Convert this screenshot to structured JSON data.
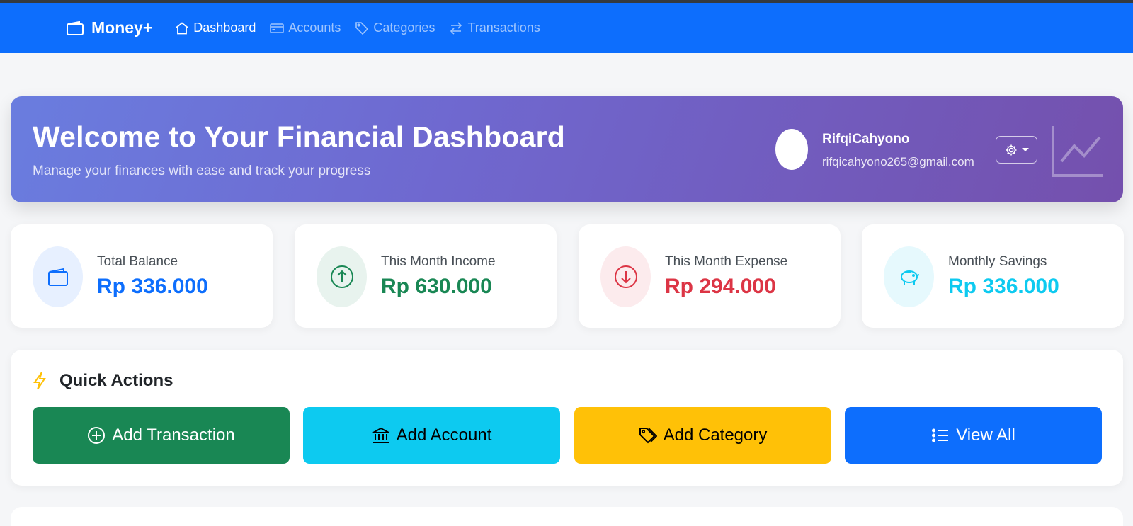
{
  "nav": {
    "brand": "Money+",
    "links": [
      {
        "label": "Dashboard",
        "icon": "house-icon",
        "active": true
      },
      {
        "label": "Accounts",
        "icon": "credit-card-icon",
        "active": false
      },
      {
        "label": "Categories",
        "icon": "tags-icon",
        "active": false
      },
      {
        "label": "Transactions",
        "icon": "arrow-left-right-icon",
        "active": false
      }
    ]
  },
  "hero": {
    "title": "Welcome to Your Financial Dashboard",
    "subtitle": "Manage your finances with ease and track your progress",
    "user_name": "RifqiCahyono",
    "user_email": "rifqicahyono265@gmail.com",
    "settings_icon": "gear-icon",
    "decor_icon": "graph-up-icon"
  },
  "stats": [
    {
      "label": "Total Balance",
      "value": "Rp 336.000",
      "icon": "wallet-icon",
      "color": "#0d6efd",
      "bg": "#e7f0ff"
    },
    {
      "label": "This Month Income",
      "value": "Rp 630.000",
      "icon": "arrow-up-circle-icon",
      "color": "#198754",
      "bg": "#e8f3ee"
    },
    {
      "label": "This Month Expense",
      "value": "Rp 294.000",
      "icon": "arrow-down-circle-icon",
      "color": "#dc3545",
      "bg": "#fcebed"
    },
    {
      "label": "Monthly Savings",
      "value": "Rp 336.000",
      "icon": "piggy-bank-icon",
      "color": "#0dcaf0",
      "bg": "#e6f9fd"
    }
  ],
  "quick_actions": {
    "title": "Quick Actions",
    "icon": "lightning-icon",
    "buttons": [
      {
        "label": "Add Transaction",
        "icon": "plus-circle-icon",
        "bg": "#198754",
        "fg": "#ffffff"
      },
      {
        "label": "Add Account",
        "icon": "bank-icon",
        "bg": "#0dcaf0",
        "fg": "#000000"
      },
      {
        "label": "Add Category",
        "icon": "tags-icon",
        "bg": "#ffc107",
        "fg": "#000000"
      },
      {
        "label": "View All",
        "icon": "list-icon",
        "bg": "#0d6efd",
        "fg": "#ffffff"
      }
    ]
  }
}
